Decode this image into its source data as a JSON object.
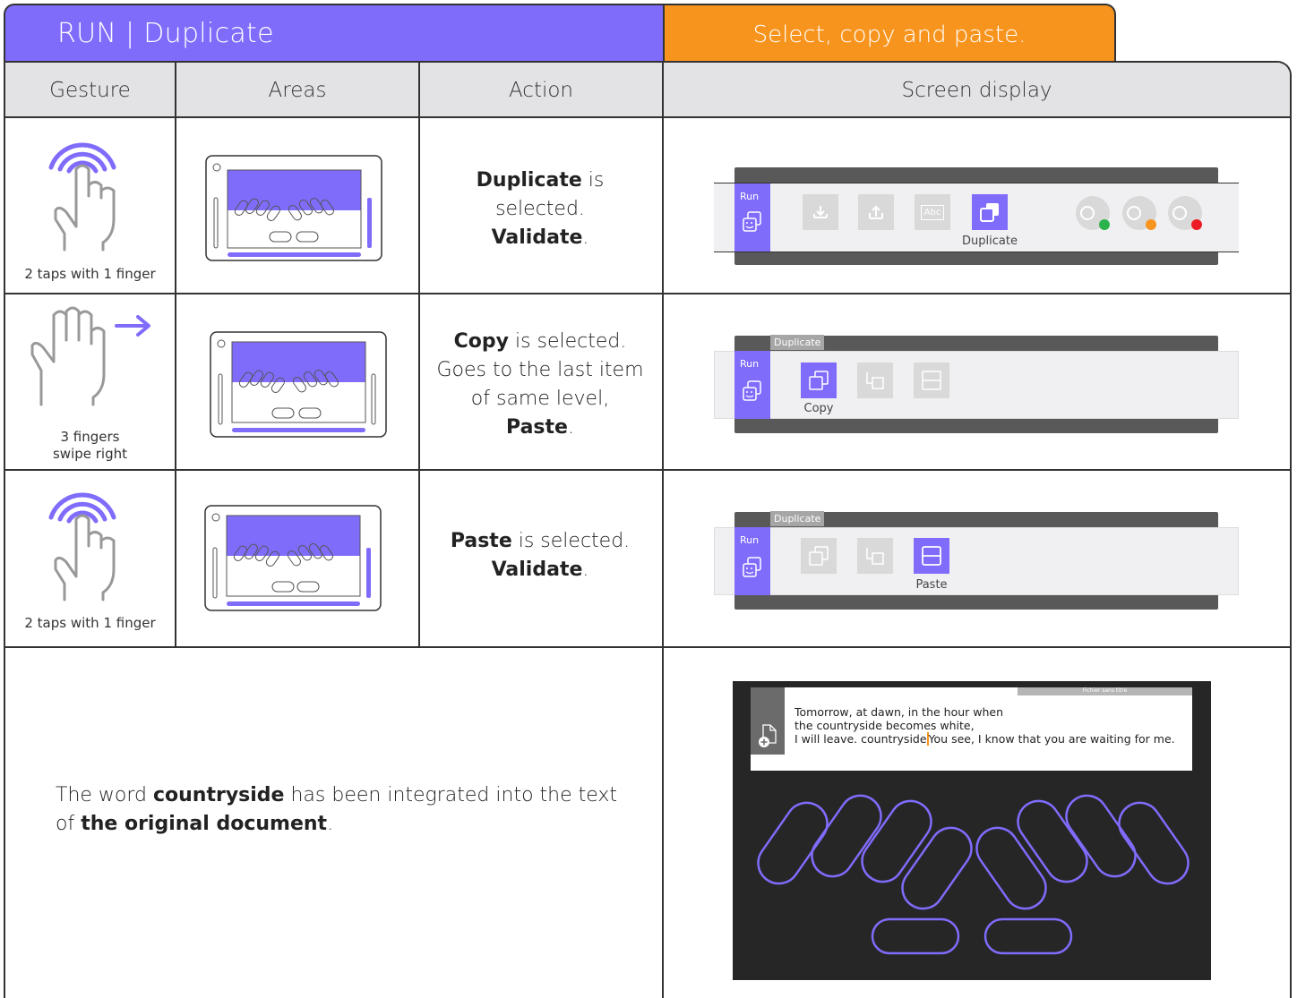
{
  "tabs": {
    "title": "RUN | Duplicate",
    "subtitle": "Select, copy and paste."
  },
  "header": {
    "gesture": "Gesture",
    "areas": "Areas",
    "action": "Action",
    "screen": "Screen display"
  },
  "colors": {
    "accent": "#7f6cfb",
    "orange": "#f7941d",
    "header_bg": "#e3e3e5"
  },
  "rows": [
    {
      "gesture_caption_1": "2 taps with 1 finger",
      "action_line1_bold": "Duplicate",
      "action_line1_rest": " is",
      "action_line2": "selected.",
      "action_line3_bold": "Validate",
      "action_line3_rest": ".",
      "run_label": "Run",
      "selected_label": "Duplicate"
    },
    {
      "gesture_caption_1": "3 fingers",
      "gesture_caption_2": "swipe right",
      "action_line1_bold": "Copy",
      "action_line1_rest": " is selected.",
      "action_line2": "Goes to the last item",
      "action_line3": "of same level,",
      "action_line4_bold": "Paste",
      "action_line4_rest": ".",
      "tag": "Duplicate",
      "run_label": "Run",
      "selected_label": "Copy"
    },
    {
      "gesture_caption_1": "2 taps with 1 finger",
      "action_line1_bold": "Paste",
      "action_line1_rest": " is selected.",
      "action_line2_bold": "Validate",
      "action_line2_rest": ".",
      "tag": "Duplicate",
      "run_label": "Run",
      "selected_label": "Paste"
    }
  ],
  "bottom": {
    "text_1": "The word ",
    "text_bold_1": "countryside",
    "text_2": " has been integrated into the text",
    "text_3": "of ",
    "text_bold_2": "the original document",
    "text_4": "."
  },
  "document": {
    "title_bar": "Fichier sans titre",
    "line1": "Tomorrow, at dawn, in the hour when",
    "line2": "the countryside becomes white,",
    "line3a": "I will leave. countryside",
    "line3b": "You see, I know that you are waiting for me."
  },
  "icons": {
    "abc": "Abc"
  }
}
